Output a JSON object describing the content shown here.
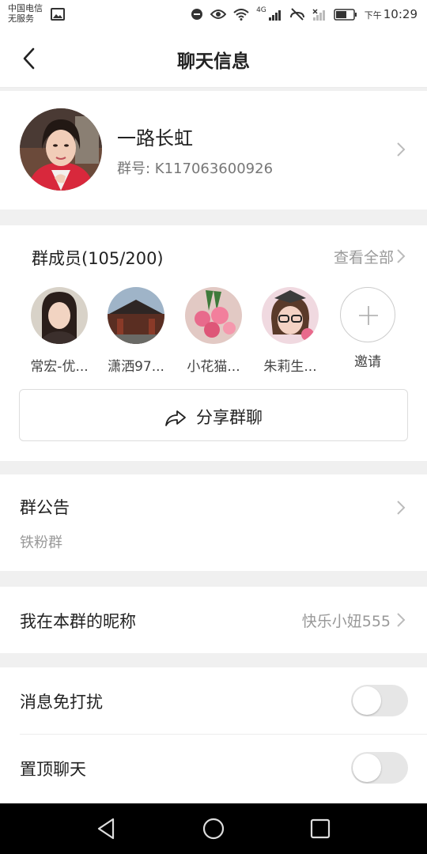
{
  "status_bar": {
    "carrier_line1": "中国电信",
    "carrier_line2": "无服务",
    "network": "4G",
    "time_prefix": "下午",
    "time": "10:29"
  },
  "header": {
    "title": "聊天信息",
    "back_icon": "chevron-left-icon"
  },
  "group": {
    "name": "一路长虹",
    "id_text": "群号: K117063600926"
  },
  "members": {
    "title": "群成员(105/200)",
    "view_all": "查看全部",
    "list": [
      {
        "name": "常宏-优..."
      },
      {
        "name": "潇洒97..."
      },
      {
        "name": "小花猫..."
      },
      {
        "name": "朱莉生..."
      }
    ],
    "invite_label": "邀请",
    "share_label": "分享群聊"
  },
  "notice": {
    "title": "群公告",
    "text": "铁粉群"
  },
  "nickname": {
    "label": "我在本群的昵称",
    "value": "快乐小妞555"
  },
  "settings": {
    "mute_label": "消息免打扰",
    "mute_on": false,
    "pin_label": "置顶聊天",
    "pin_on": false
  },
  "colors": {
    "background": "#f0f0f0",
    "toggle_off": "#e6e6e6",
    "secondary_text": "#999999"
  }
}
